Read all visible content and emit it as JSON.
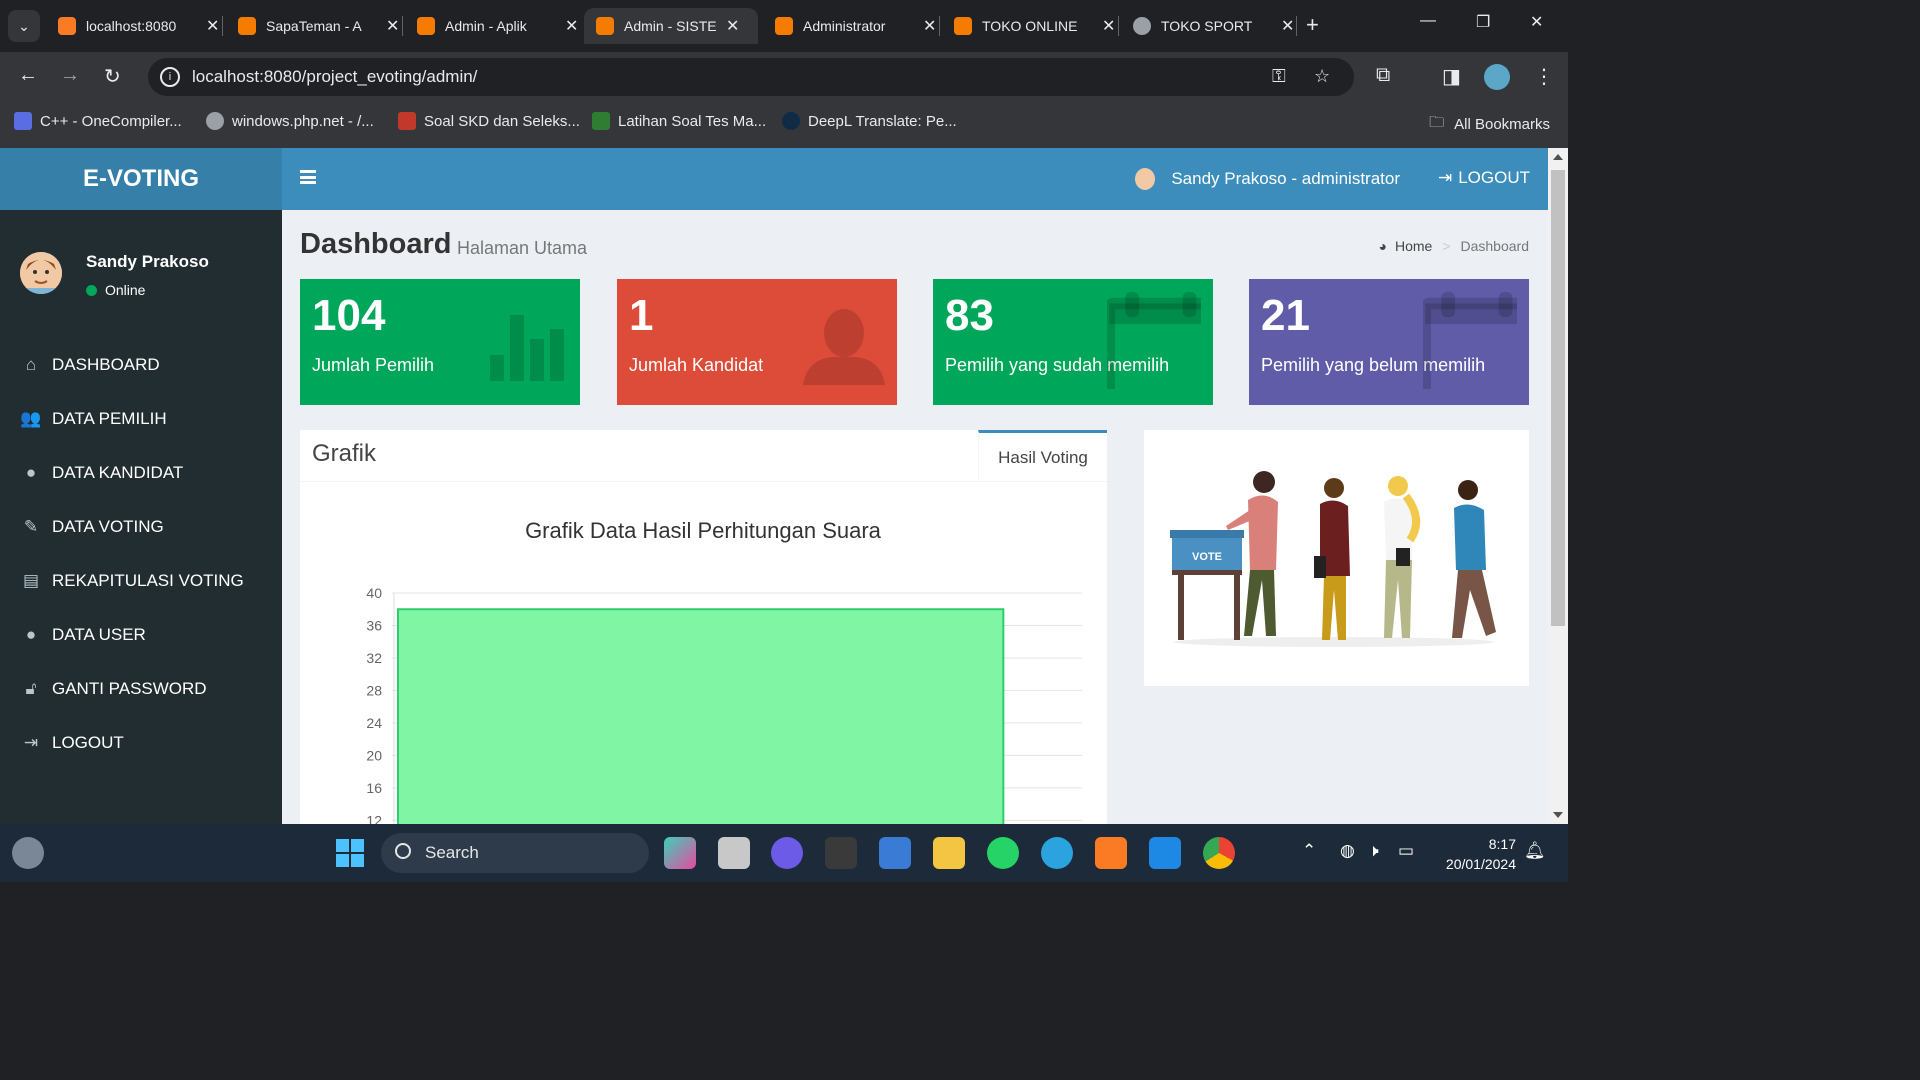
{
  "browser": {
    "tabs": [
      {
        "title": "localhost:8080",
        "icon": "xampp-icon",
        "active": false
      },
      {
        "title": "SapaTeman - A",
        "icon": "codeigniter-icon",
        "active": false
      },
      {
        "title": "Admin - Aplik",
        "icon": "codeigniter-icon",
        "active": false
      },
      {
        "title": "Admin - SISTE",
        "icon": "codeigniter-icon",
        "active": true
      },
      {
        "title": "Administrator",
        "icon": "codeigniter-icon",
        "active": false
      },
      {
        "title": "TOKO ONLINE",
        "icon": "codeigniter-icon",
        "active": false
      },
      {
        "title": "TOKO SPORT",
        "icon": "globe-icon",
        "active": false
      }
    ],
    "url": "localhost:8080/project_evoting/admin/",
    "bookmarks": [
      {
        "label": "C++ - OneCompiler..."
      },
      {
        "label": "windows.php.net - /..."
      },
      {
        "label": "Soal SKD dan Seleks..."
      },
      {
        "label": "Latihan Soal Tes Ma..."
      },
      {
        "label": "DeepL Translate: Pe..."
      }
    ],
    "all_bookmarks": "All Bookmarks"
  },
  "app": {
    "logo": "E-VOTING",
    "user": {
      "name": "Sandy Prakoso",
      "status": "Online"
    },
    "menu": [
      {
        "label": "DASHBOARD",
        "icon": "dashboard-icon"
      },
      {
        "label": "DATA PEMILIH",
        "icon": "users-icon"
      },
      {
        "label": "DATA KANDIDAT",
        "icon": "user-icon"
      },
      {
        "label": "DATA VOTING",
        "icon": "pencil-icon"
      },
      {
        "label": "REKAPITULASI VOTING",
        "icon": "file-icon"
      },
      {
        "label": "DATA USER",
        "icon": "user-icon"
      },
      {
        "label": "GANTI PASSWORD",
        "icon": "unlock-icon"
      },
      {
        "label": "LOGOUT",
        "icon": "sign-out-icon"
      }
    ],
    "topbar": {
      "user_label": "Sandy Prakoso - administrator",
      "logout": "LOGOUT"
    },
    "page": {
      "title": "Dashboard",
      "subtitle": "Halaman Utama"
    },
    "breadcrumb": {
      "home": "Home",
      "current": "Dashboard"
    },
    "stats": [
      {
        "value": "104",
        "label": "Jumlah Pemilih",
        "color": "#00a65a",
        "icon": "bar-chart-icon"
      },
      {
        "value": "1",
        "label": "Jumlah Kandidat",
        "color": "#dd4b39",
        "icon": "person-icon"
      },
      {
        "value": "83",
        "label": "Pemilih yang sudah memilih",
        "color": "#00a65a",
        "icon": "calendar-icon"
      },
      {
        "value": "21",
        "label": "Pemilih yang belum memilih",
        "color": "#605ca8",
        "icon": "calendar-icon"
      }
    ],
    "grafik": {
      "title": "Grafik",
      "tab": "Hasil Voting"
    },
    "illustration": {
      "sign": "VOTE"
    }
  },
  "chart_data": {
    "type": "bar",
    "title": "Grafik Data Hasil Perhitungan Suara",
    "categories": [
      ""
    ],
    "values": [
      38
    ],
    "y_ticks": [
      12,
      16,
      20,
      24,
      28,
      32,
      36,
      40
    ],
    "ylim": [
      12,
      40
    ],
    "bar_fill": "#80f5a4",
    "bar_stroke": "#2ecc71",
    "grid": true
  },
  "taskbar": {
    "search": "Search",
    "time": "8:17",
    "date": "20/01/2024"
  }
}
